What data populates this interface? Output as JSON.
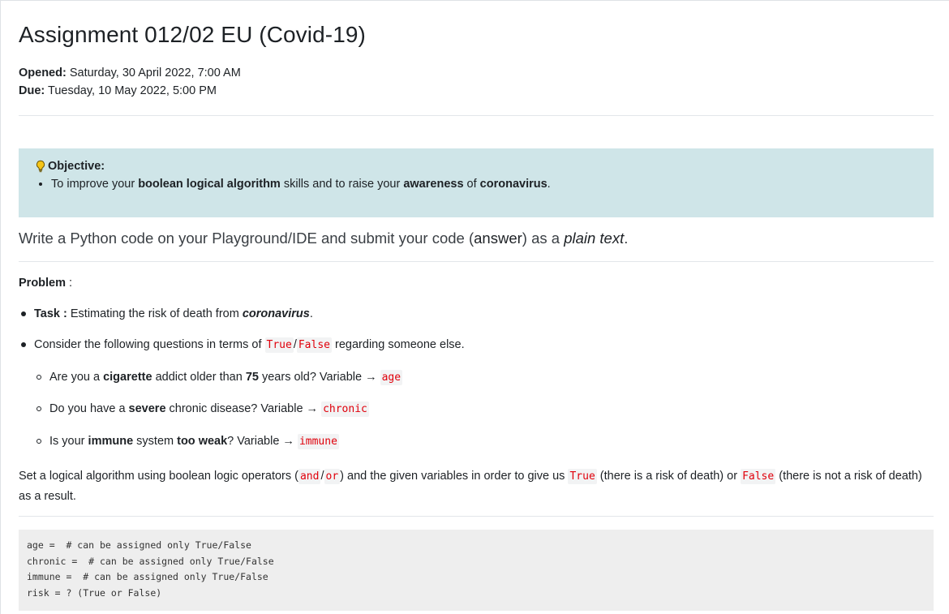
{
  "assignment": {
    "title": "Assignment 012/02 EU (Covid-19)",
    "opened_label": "Opened:",
    "opened_value": "Saturday, 30 April 2022, 7:00 AM",
    "due_label": "Due:",
    "due_value": "Tuesday, 10 May 2022, 5:00 PM"
  },
  "objective": {
    "heading": "Objective:",
    "icon": "lightbulb-icon",
    "text_1": "To improve your ",
    "bold_1": "boolean logical algorithm",
    "text_2": " skills and to raise your ",
    "bold_2": "awareness",
    "text_3": " of ",
    "bold_3": "coronavirus",
    "text_4": "."
  },
  "instruction": {
    "text_1": "Write a Python code on your Playground/IDE and submit your code (",
    "answer": "answer",
    "text_2": ") as a ",
    "plain": "plain text",
    "text_3": "."
  },
  "problem": {
    "label": "Problem",
    "suffix": " :",
    "task_label": "Task :",
    "task_text": " Estimating the risk of death from ",
    "task_bold": "coronavirus",
    "task_end": ".",
    "consider_1": "Consider the following questions in terms of ",
    "true_code": "True",
    "slash": "/",
    "false_code": "False",
    "consider_2": " regarding someone else.",
    "q1_a": "Are you a ",
    "q1_b": "cigarette",
    "q1_c": " addict older than ",
    "q1_d": "75",
    "q1_e": " years old? Variable → ",
    "q1_var": "age",
    "q2_a": "Do you have a ",
    "q2_b": "severe",
    "q2_c": " chronic disease? Variable → ",
    "q2_var": "chronic",
    "q3_a": "Is your ",
    "q3_b": "immune",
    "q3_c": " system ",
    "q3_d": "too weak",
    "q3_e": "? Variable → ",
    "q3_var": "immune",
    "set_1": "Set a logical algorithm using boolean logic operators (",
    "and": "and",
    "or": "or",
    "set_2": ") and the given variables in order to give us ",
    "set_true": "True",
    "set_3": " (there is a risk of death) or ",
    "set_false": "False",
    "set_4": " (there is not a risk of death) as a result."
  },
  "code_block": {
    "line_1": "age =  # can be assigned only True/False",
    "line_2": "chronic =  # can be assigned only True/False",
    "line_3": "immune =  # can be assigned only True/False",
    "line_4": "risk = ? (True or False)"
  },
  "colors": {
    "code_text": "#e0000b",
    "objective_bg": "#cfe5e8",
    "code_block_bg": "#eeeeee"
  }
}
